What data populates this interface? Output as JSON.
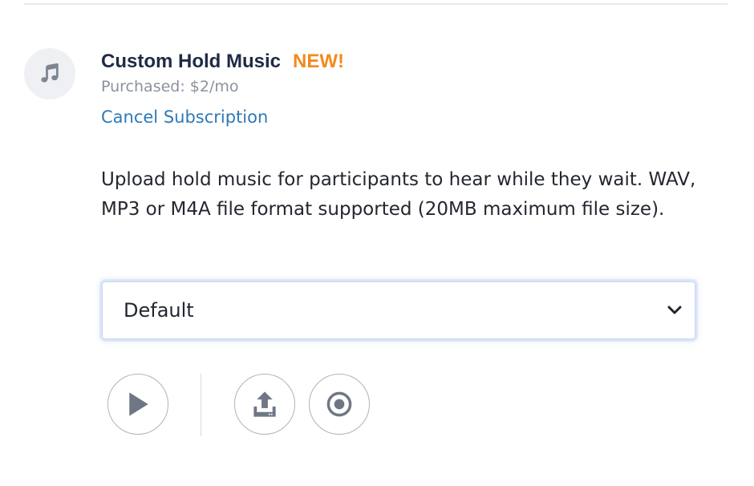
{
  "addon": {
    "title": "Custom Hold Music",
    "badge": "NEW!",
    "purchased": "Purchased: $2/mo",
    "cancel_link": "Cancel Subscription",
    "description": "Upload hold music for participants to hear while they wait. WAV, MP3 or M4A file format supported (20MB maximum file size).",
    "icon": "music-note-icon"
  },
  "music_select": {
    "selected": "Default"
  },
  "controls": {
    "play_icon": "play-icon",
    "upload_icon": "upload-icon",
    "record_icon": "record-icon"
  },
  "colors": {
    "title": "#1f2b45",
    "badge": "#f28a1e",
    "link": "#2e79b8",
    "icon_gray": "#7d8593"
  }
}
